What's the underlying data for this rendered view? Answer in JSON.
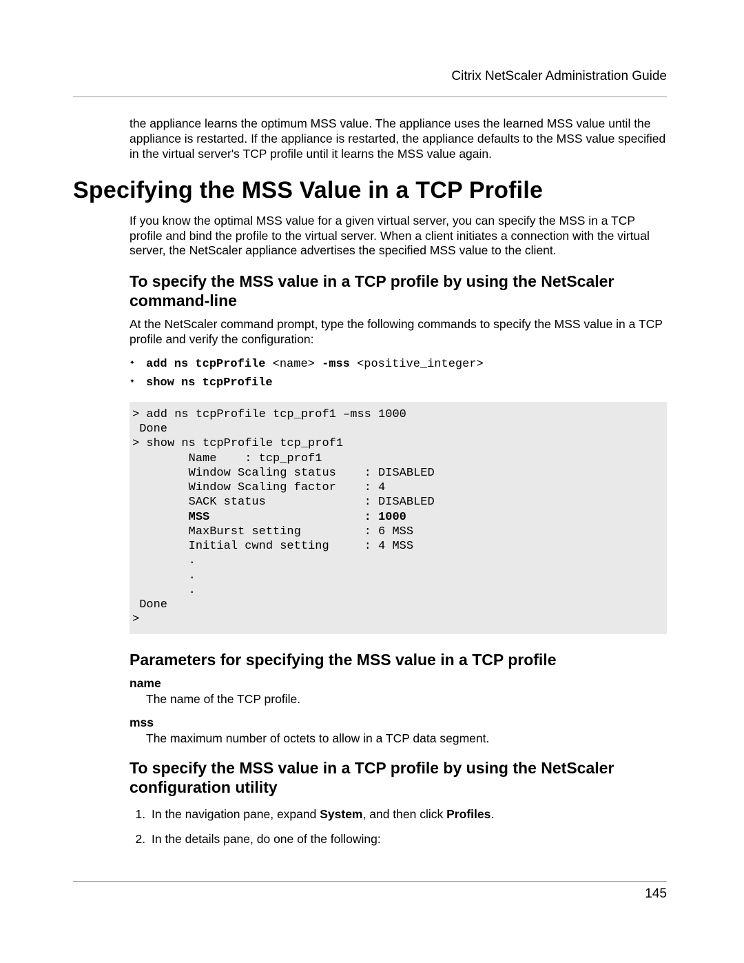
{
  "header": {
    "doc_title": "Citrix NetScaler Administration Guide"
  },
  "intro_para": "the appliance learns the optimum MSS value. The appliance uses the learned MSS value until the appliance is restarted. If the appliance is restarted, the appliance defaults to the MSS value specified in the virtual server's TCP profile until it learns the MSS value again.",
  "h1": "Specifying the MSS Value in a TCP Profile",
  "h1_para": "If you know the optimal MSS value for a given virtual server, you can specify the MSS in a TCP profile and bind the profile to the virtual server. When a client initiates a connection with the virtual server, the NetScaler appliance advertises the specified MSS value to the client.",
  "h2a": "To specify the MSS value in a TCP profile by using the NetScaler command-line",
  "h2a_para": "At the NetScaler command prompt, type the following commands to specify the MSS value in a TCP profile and verify the configuration:",
  "cmd_bullets": {
    "b1_kw": "add ns tcpProfile",
    "b1_rest": " <name> ",
    "b1_kw2": "-mss",
    "b1_rest2": " <positive_integer>",
    "b2_kw": "show ns tcpProfile"
  },
  "code": {
    "l1": "> add ns tcpProfile tcp_prof1 –mss 1000",
    "l2": " Done",
    "l3": "> show ns tcpProfile tcp_prof1",
    "l4": "        Name    : tcp_prof1",
    "l5": "        Window Scaling status    : DISABLED",
    "l6": "        Window Scaling factor    : 4",
    "l7": "        SACK status              : DISABLED",
    "l8a": "        MSS                      : 1000",
    "l9": "        MaxBurst setting         : 6 MSS",
    "l10": "        Initial cwnd setting     : 4 MSS",
    "dot": "        .",
    "l14": " Done",
    "l15": ">"
  },
  "h2b": "Parameters for specifying the MSS value in a TCP profile",
  "params": {
    "p1_name": "name",
    "p1_desc": "The name of the TCP profile.",
    "p2_name": "mss",
    "p2_desc": "The maximum number of octets to allow in a TCP data segment."
  },
  "h2c": "To specify the MSS value in a TCP profile by using the NetScaler configuration utility",
  "steps": {
    "s1_pre": "In the navigation pane, expand ",
    "s1_b1": "System",
    "s1_mid": ", and then click ",
    "s1_b2": "Profiles",
    "s1_post": ".",
    "s2": "In the details pane, do one of the following:"
  },
  "page_number": "145"
}
